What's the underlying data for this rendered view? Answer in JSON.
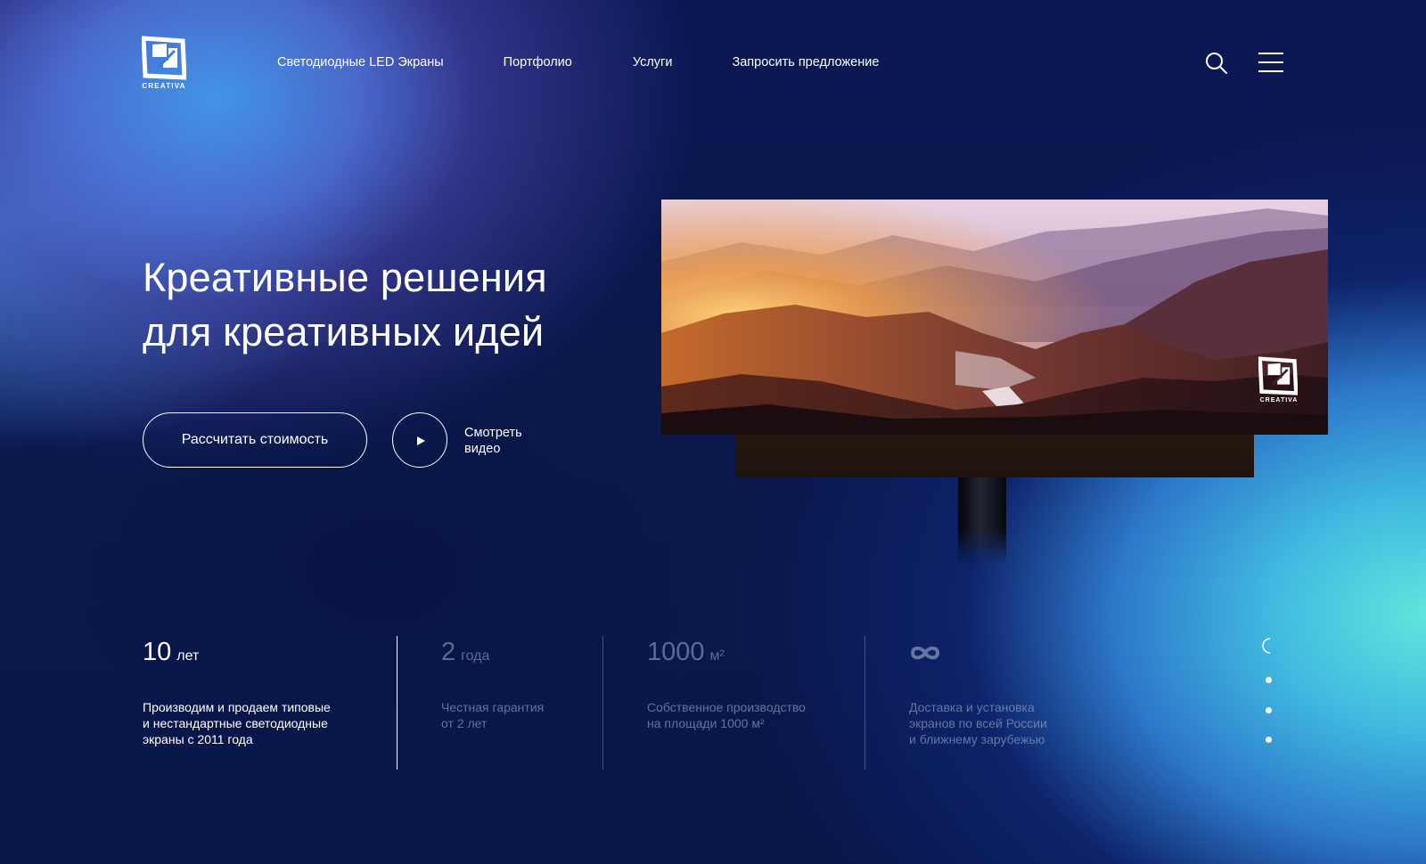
{
  "brand": {
    "name": "CREATIVA"
  },
  "nav": {
    "items": [
      "Светодиодные LED Экраны",
      "Портфолио",
      "Услуги",
      "Запросить предложение"
    ]
  },
  "header": {
    "search_icon": "search-icon",
    "menu_icon": "hamburger-menu-icon"
  },
  "hero": {
    "title_line1": "Креативные решения",
    "title_line2": "для креативных идей",
    "calc_button": "Рассчитать стоимость",
    "watch_line1": "Смотреть",
    "watch_line2": "видео",
    "play_icon": "play-icon"
  },
  "billboard": {
    "screen_logo_text": "CREATIVA"
  },
  "stats": [
    {
      "value": "10",
      "unit": "лет",
      "desc": [
        "Производим и продаем типовые",
        "и нестандартные светодиодные",
        "экраны с 2011 года"
      ]
    },
    {
      "value": "2",
      "unit": "года",
      "desc": [
        "Честная гарантия",
        "от 2 лет"
      ]
    },
    {
      "value": "1000",
      "unit": "м²",
      "desc": [
        "Собственное производство",
        "на площади 1000 м²"
      ]
    },
    {
      "value": "∞",
      "unit": "",
      "desc": [
        "Доставка и установка",
        "экранов по всей России",
        "и ближнему зарубежью"
      ]
    }
  ],
  "colors": {
    "accent_teal": "#5fe6dc",
    "deep_blue": "#0b1854",
    "light_blue": "#4294e8"
  }
}
